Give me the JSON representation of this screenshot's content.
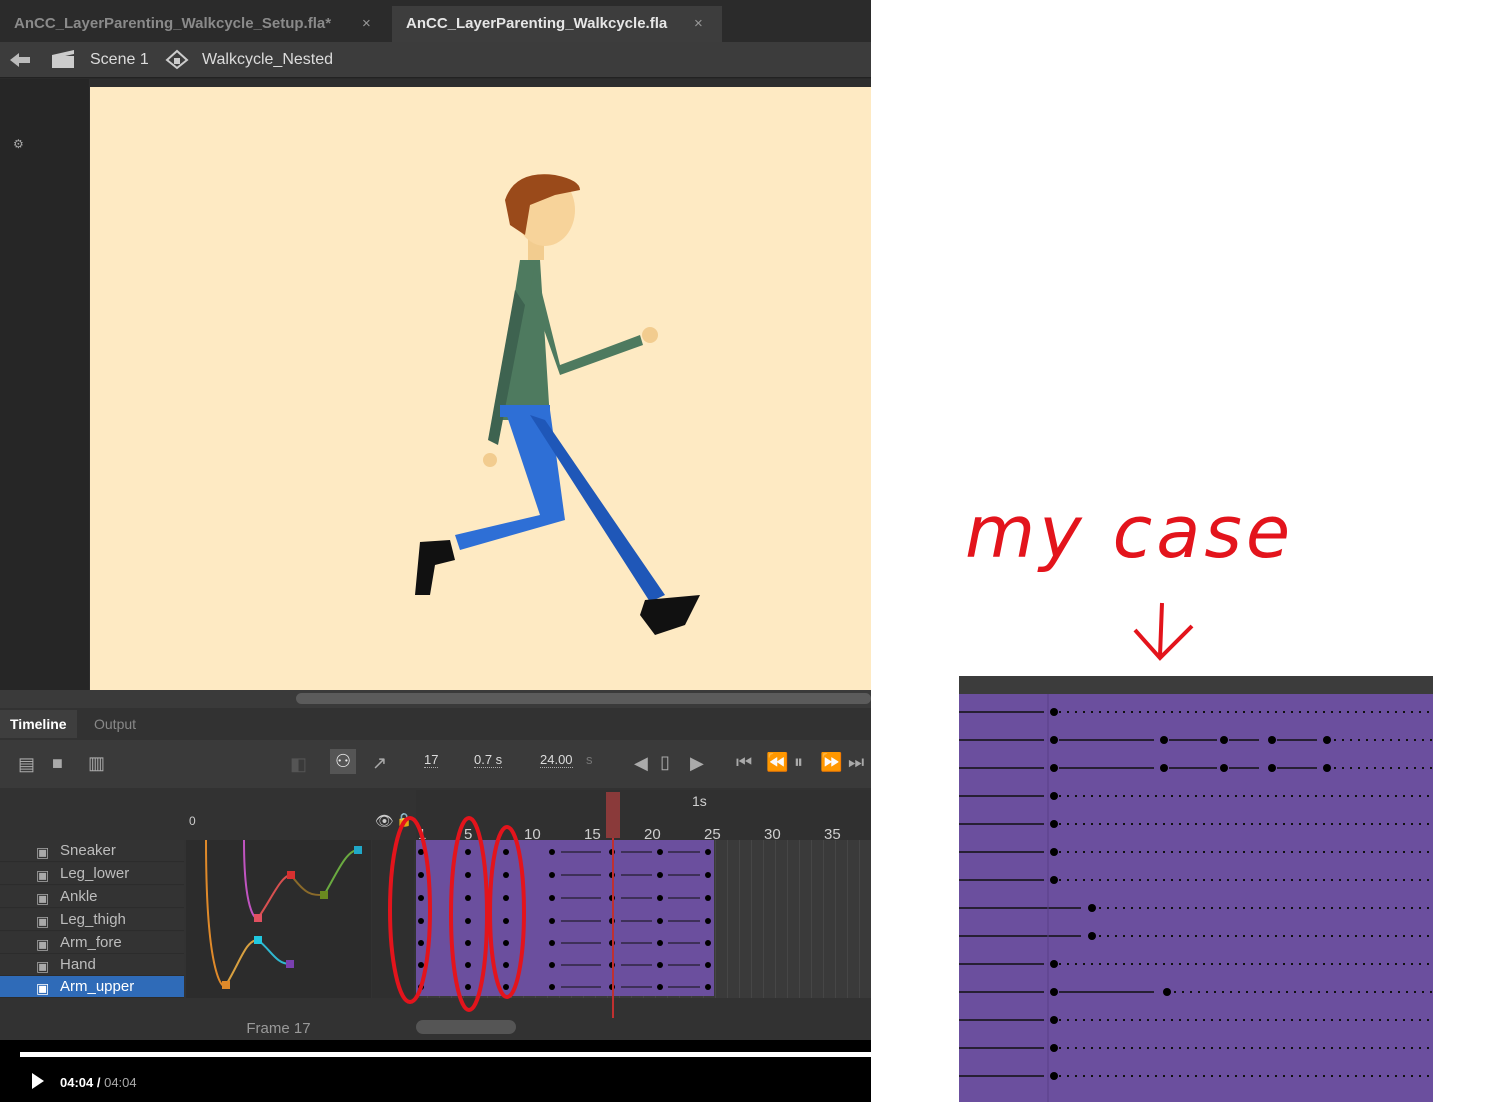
{
  "tabs": [
    {
      "label": "AnCC_LayerParenting_Walkcycle_Setup.fla*",
      "close": "×"
    },
    {
      "label": "AnCC_LayerParenting_Walkcycle.fla",
      "close": "×"
    }
  ],
  "nav": {
    "scene": "Scene 1",
    "symbol": "Walkcycle_Nested"
  },
  "panel_tabs": [
    "Timeline",
    "Output"
  ],
  "timeline": {
    "frame_num": "17",
    "time": "0.7 s",
    "fps": "24.00",
    "fps_unit": "s",
    "second_marker": "1s",
    "ruler": [
      "1",
      "5",
      "10",
      "15",
      "20",
      "25",
      "30",
      "35"
    ],
    "layers": [
      "Sneaker",
      "Leg_lower",
      "Ankle",
      "Leg_thigh",
      "Arm_fore",
      "Hand",
      "Arm_upper"
    ],
    "graph_zero": "0",
    "footer": "Frame  17"
  },
  "video": {
    "current": "04:04",
    "sep": " / ",
    "total": "04:04",
    "progress": 1.0
  },
  "annotation": {
    "text": "my case"
  },
  "colors": {
    "frame_purple": "#6b4f9e",
    "annotation_red": "#e3141c",
    "selection_blue": "#2f6bb8"
  }
}
